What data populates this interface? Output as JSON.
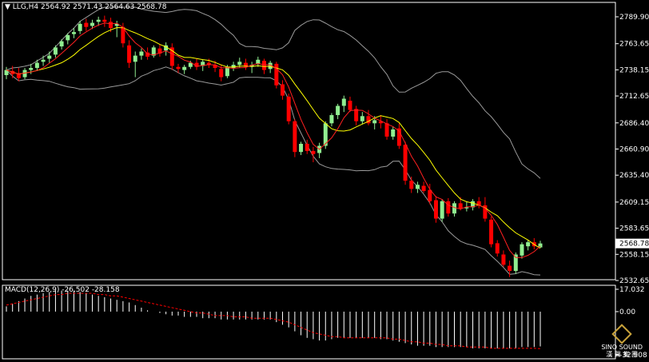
{
  "header": {
    "symbol_line": "LLG,H4  2564.92 2571.43 2564.63 2568.78",
    "macd_line": "MACD(12,26,9) -26.502 -28.158"
  },
  "logo": {
    "text": "SINO SOUND",
    "sub": "漢 聲 集 團"
  },
  "colors": {
    "bull": "#90ee90",
    "bear": "#ff0000",
    "ma_fast": "#ff2020",
    "ma_slow": "#ffff00",
    "bands": "#9a9a9a",
    "macd_hist": "#ffffff",
    "macd_signal": "#ff0000",
    "current_price_bg": "#ffffff",
    "background": "#000000"
  },
  "chart_data": [
    {
      "type": "candlestick",
      "title": "LLG,H4",
      "ylim": [
        2532.65,
        2789.9
      ],
      "y_ticks": [
        "2789.90",
        "2763.65",
        "2738.15",
        "2712.65",
        "2686.40",
        "2660.90",
        "2635.40",
        "2609.15",
        "2583.65",
        "2558.15",
        "2532.65"
      ],
      "current_price": "2568.78",
      "candles": [
        [
          2733,
          2741,
          2729,
          2738
        ],
        [
          2737,
          2742,
          2730,
          2734
        ],
        [
          2735,
          2740,
          2727,
          2730
        ],
        [
          2731,
          2740,
          2729,
          2738
        ],
        [
          2738,
          2744,
          2734,
          2740
        ],
        [
          2740,
          2748,
          2737,
          2745
        ],
        [
          2746,
          2752,
          2742,
          2748
        ],
        [
          2749,
          2756,
          2745,
          2752
        ],
        [
          2753,
          2762,
          2750,
          2760
        ],
        [
          2761,
          2768,
          2758,
          2766
        ],
        [
          2767,
          2774,
          2763,
          2772
        ],
        [
          2773,
          2779,
          2769,
          2775
        ],
        [
          2776,
          2786,
          2773,
          2783
        ],
        [
          2784,
          2788,
          2776,
          2780
        ],
        [
          2781,
          2787,
          2778,
          2784
        ],
        [
          2785,
          2790,
          2781,
          2787
        ],
        [
          2787,
          2791,
          2780,
          2785
        ],
        [
          2785,
          2789,
          2775,
          2779
        ],
        [
          2781,
          2786,
          2770,
          2783
        ],
        [
          2780,
          2784,
          2760,
          2764
        ],
        [
          2762,
          2767,
          2740,
          2745
        ],
        [
          2746,
          2756,
          2731,
          2752
        ],
        [
          2752,
          2759,
          2748,
          2756
        ],
        [
          2755,
          2760,
          2748,
          2751
        ],
        [
          2752,
          2762,
          2750,
          2760
        ],
        [
          2759,
          2763,
          2751,
          2754
        ],
        [
          2757,
          2765,
          2752,
          2762
        ],
        [
          2760,
          2764,
          2738,
          2742
        ],
        [
          2741,
          2744,
          2735,
          2739
        ],
        [
          2738,
          2743,
          2734,
          2741
        ],
        [
          2741,
          2747,
          2739,
          2745
        ],
        [
          2745,
          2749,
          2738,
          2741
        ],
        [
          2742,
          2748,
          2737,
          2746
        ],
        [
          2745,
          2749,
          2740,
          2743
        ],
        [
          2743,
          2747,
          2736,
          2740
        ],
        [
          2739,
          2743,
          2727,
          2731
        ],
        [
          2732,
          2743,
          2730,
          2741
        ],
        [
          2740,
          2746,
          2737,
          2743
        ],
        [
          2743,
          2750,
          2740,
          2746
        ],
        [
          2745,
          2749,
          2738,
          2741
        ],
        [
          2741,
          2746,
          2735,
          2743
        ],
        [
          2744,
          2751,
          2741,
          2748
        ],
        [
          2747,
          2749,
          2734,
          2738
        ],
        [
          2739,
          2747,
          2735,
          2745
        ],
        [
          2744,
          2746,
          2720,
          2723
        ],
        [
          2724,
          2728,
          2709,
          2713
        ],
        [
          2712,
          2715,
          2685,
          2688
        ],
        [
          2688,
          2690,
          2653,
          2658
        ],
        [
          2658,
          2668,
          2655,
          2666
        ],
        [
          2666,
          2670,
          2656,
          2659
        ],
        [
          2659,
          2663,
          2648,
          2656
        ],
        [
          2657,
          2667,
          2652,
          2664
        ],
        [
          2664,
          2688,
          2661,
          2686
        ],
        [
          2686,
          2696,
          2683,
          2694
        ],
        [
          2694,
          2705,
          2690,
          2703
        ],
        [
          2703,
          2713,
          2697,
          2710
        ],
        [
          2708,
          2712,
          2697,
          2699
        ],
        [
          2700,
          2703,
          2684,
          2688
        ],
        [
          2688,
          2697,
          2685,
          2693
        ],
        [
          2693,
          2699,
          2684,
          2686
        ],
        [
          2686,
          2693,
          2680,
          2689
        ],
        [
          2688,
          2694,
          2681,
          2686
        ],
        [
          2686,
          2690,
          2670,
          2673
        ],
        [
          2673,
          2683,
          2670,
          2680
        ],
        [
          2681,
          2686,
          2661,
          2664
        ],
        [
          2665,
          2668,
          2626,
          2630
        ],
        [
          2630,
          2634,
          2618,
          2622
        ],
        [
          2622,
          2629,
          2618,
          2626
        ],
        [
          2625,
          2629,
          2618,
          2620
        ],
        [
          2621,
          2627,
          2607,
          2610
        ],
        [
          2611,
          2615,
          2589,
          2593
        ],
        [
          2593,
          2612,
          2590,
          2610
        ],
        [
          2610,
          2613,
          2595,
          2598
        ],
        [
          2598,
          2610,
          2595,
          2608
        ],
        [
          2608,
          2614,
          2601,
          2603
        ],
        [
          2603,
          2610,
          2600,
          2604
        ],
        [
          2604,
          2612,
          2601,
          2610
        ],
        [
          2610,
          2614,
          2603,
          2606
        ],
        [
          2606,
          2614,
          2590,
          2593
        ],
        [
          2592,
          2595,
          2565,
          2568
        ],
        [
          2569,
          2572,
          2556,
          2559
        ],
        [
          2558,
          2562,
          2546,
          2548
        ],
        [
          2547,
          2552,
          2536,
          2542
        ],
        [
          2542,
          2560,
          2539,
          2558
        ],
        [
          2557,
          2570,
          2554,
          2568
        ],
        [
          2566,
          2572,
          2562,
          2570
        ],
        [
          2570,
          2574,
          2563,
          2566
        ],
        [
          2564.92,
          2571.43,
          2564.63,
          2568.78
        ]
      ]
    },
    {
      "type": "bar",
      "title": "MACD(12,26,9)",
      "y_ticks": [
        "17.032",
        "0.00",
        "-32.908"
      ],
      "ylim": [
        -32.908,
        17.032
      ],
      "series": [
        {
          "name": "MACD",
          "values": [
            4,
            6,
            8,
            10,
            12,
            13,
            14,
            15,
            16,
            16,
            16,
            16,
            15,
            14,
            13,
            12,
            11,
            10,
            9,
            8,
            7,
            5,
            3,
            1,
            0,
            -1,
            -2,
            -3,
            -3,
            -4,
            -4,
            -4,
            -5,
            -5,
            -5,
            -6,
            -6,
            -6,
            -6,
            -6,
            -6,
            -6,
            -6,
            -6,
            -8,
            -10,
            -12,
            -15,
            -18,
            -20,
            -21,
            -22,
            -22,
            -21,
            -20,
            -20,
            -20,
            -20,
            -20,
            -20,
            -20,
            -21,
            -21,
            -22,
            -23,
            -24,
            -25,
            -26,
            -26,
            -26,
            -27,
            -27,
            -27,
            -27,
            -27,
            -27,
            -28,
            -28,
            -28,
            -28,
            -28,
            -28,
            -28,
            -28,
            -27,
            -27,
            -27,
            -26.502
          ]
        },
        {
          "name": "Signal",
          "values": [
            5,
            6,
            7,
            8,
            9,
            10,
            11,
            12,
            13,
            13,
            14,
            14,
            14,
            14,
            14,
            13,
            13,
            12,
            12,
            11,
            10,
            9,
            8,
            7,
            6,
            5,
            4,
            3,
            2,
            1,
            0,
            -1,
            -1,
            -2,
            -3,
            -3,
            -3,
            -4,
            -4,
            -4,
            -5,
            -5,
            -5,
            -5,
            -6,
            -7,
            -8,
            -10,
            -12,
            -14,
            -16,
            -17,
            -18,
            -19,
            -19,
            -20,
            -20,
            -20,
            -20,
            -20,
            -20,
            -20,
            -20,
            -21,
            -21,
            -22,
            -23,
            -23,
            -24,
            -24,
            -25,
            -25,
            -26,
            -26,
            -26,
            -27,
            -27,
            -27,
            -27,
            -28,
            -28,
            -28,
            -28,
            -28,
            -28,
            -28,
            -28,
            -28.158
          ]
        }
      ]
    }
  ]
}
